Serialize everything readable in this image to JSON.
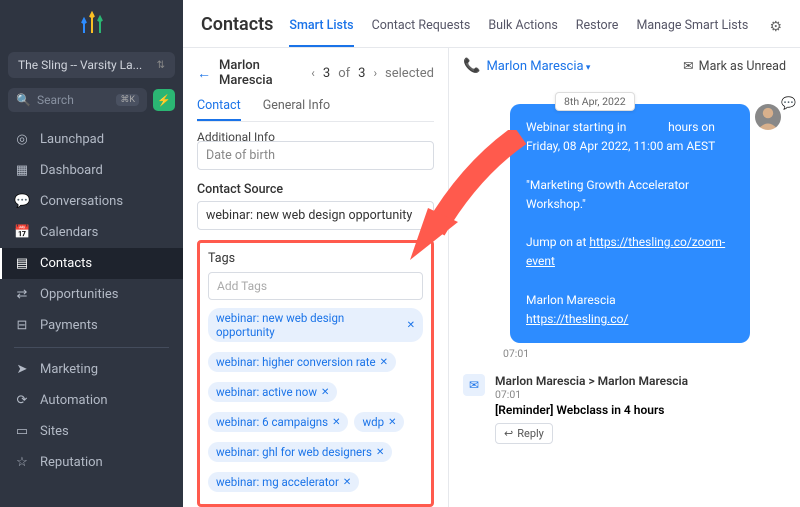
{
  "workspace": {
    "name": "The Sling -- Varsity La..."
  },
  "search": {
    "placeholder": "Search",
    "kbd": "⌘K"
  },
  "nav": [
    {
      "icon": "◎",
      "label": "Launchpad"
    },
    {
      "icon": "▦",
      "label": "Dashboard"
    },
    {
      "icon": "💬",
      "label": "Conversations"
    },
    {
      "icon": "📅",
      "label": "Calendars"
    },
    {
      "icon": "▤",
      "label": "Contacts",
      "active": true
    },
    {
      "icon": "⇄",
      "label": "Opportunities"
    },
    {
      "icon": "⊟",
      "label": "Payments"
    }
  ],
  "nav2": [
    {
      "icon": "➤",
      "label": "Marketing"
    },
    {
      "icon": "⟳",
      "label": "Automation"
    },
    {
      "icon": "▭",
      "label": "Sites"
    },
    {
      "icon": "☆",
      "label": "Reputation"
    }
  ],
  "header": {
    "title": "Contacts"
  },
  "topTabs": [
    "Smart Lists",
    "Contact Requests",
    "Bulk Actions",
    "Restore",
    "Manage Smart Lists"
  ],
  "pager": {
    "name": "Marlon Marescia",
    "pos": "3",
    "of": "3",
    "word": "selected",
    "ofw": "of"
  },
  "subTabs": [
    "Contact",
    "General Info"
  ],
  "additionalInfo": "Additional Info",
  "dob_placeholder": "Date of birth",
  "source": {
    "label": "Contact Source",
    "value": "webinar: new web design opportunity"
  },
  "tags": {
    "label": "Tags",
    "placeholder": "Add Tags",
    "items": [
      "webinar: new web design opportunity",
      "webinar: higher conversion rate",
      "webinar: active now",
      "webinar: 6 campaigns",
      "wdp",
      "webinar: ghl for web designers",
      "webinar: mg accelerator"
    ]
  },
  "convo": {
    "name": "Marlon Marescia",
    "unread": "Mark as Unread",
    "date_badge": "8th Apr, 2022",
    "msg_line1a": "Webinar starting in",
    "msg_line1b": "hours on",
    "msg_line2": "Friday, 08 Apr 2022, 11:00 am  AEST",
    "msg_quote": "\"Marketing Growth Accelerator Workshop.\"",
    "msg_jump": "Jump on at ",
    "msg_link1": "https://thesling.co/zoom-event",
    "msg_sig": "Marlon Marescia",
    "msg_link2": "https://thesling.co/",
    "time": "07:01",
    "reply_from": "Marlon Marescia > Marlon Marescia",
    "reply_time": "07:01",
    "reply_subj": "[Reminder] Webclass in 4 hours",
    "reply_btn": "Reply"
  }
}
